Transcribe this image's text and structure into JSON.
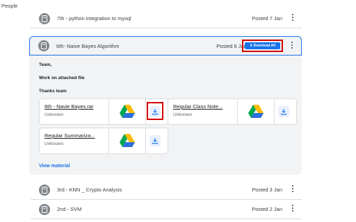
{
  "nav": {
    "people_label": "People"
  },
  "posts_above": [
    {
      "title": "7th - python integration to mysql",
      "date": "Posted 7 Jan"
    }
  ],
  "expanded_post": {
    "title": "6th- Naive Bayes Algorithm",
    "date": "Posted 6 Jan",
    "download_all_label": "⬇ Download All",
    "body": {
      "greeting": "Team,",
      "message": "Work on attached file",
      "signoff": "Thanks team"
    },
    "attachments": [
      {
        "name": "6th - Navie Bayes.rar",
        "subtitle": "Unknown"
      },
      {
        "name": "Regular Class Note...",
        "subtitle": "Unknown"
      },
      {
        "name": "Regular Summariza...",
        "subtitle": "Unknown"
      }
    ],
    "view_material_label": "View material"
  },
  "posts_below": [
    {
      "title": "3rd - KNN _ Crypto Analysis",
      "date": "Posted 3 Jan"
    },
    {
      "title": "2nd - SVM",
      "date": "Posted 2 Jan"
    }
  ],
  "colors": {
    "accent": "#1a73e8",
    "highlight": "#d50000",
    "panel": "#f1f3f4"
  },
  "icons": {
    "post": "assignment-icon",
    "kebab": "more-vert-icon",
    "drive": "google-drive-icon",
    "download": "download-icon"
  }
}
